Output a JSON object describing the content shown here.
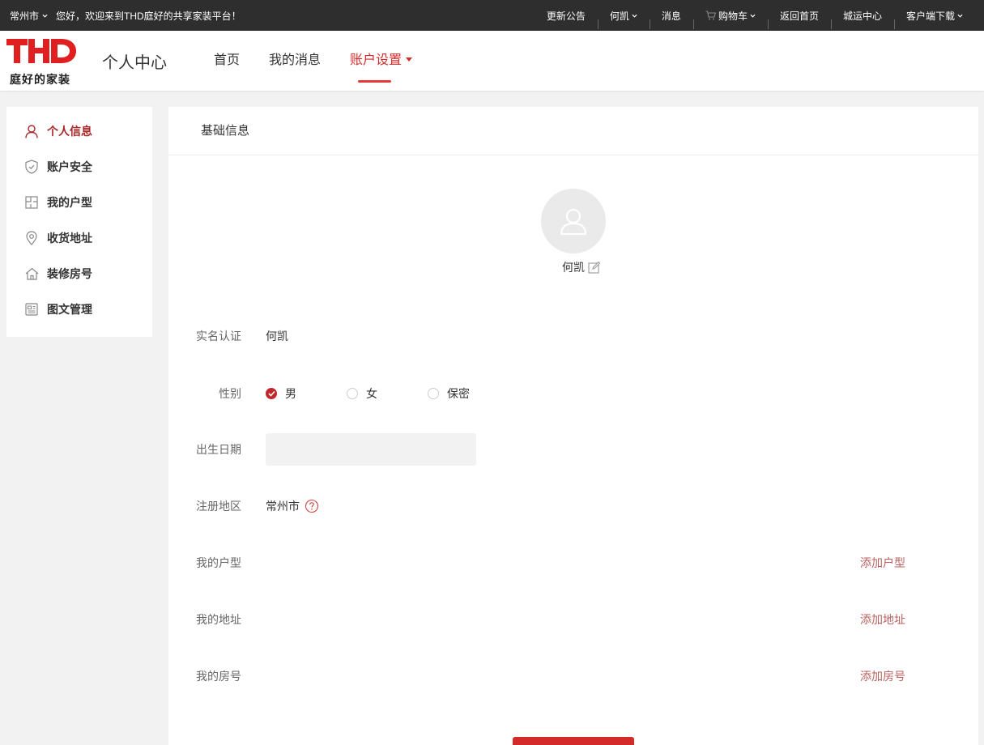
{
  "topbar": {
    "city": "常州市",
    "welcome": "您好，欢迎来到THD庭好的共享家装平台！",
    "links": [
      {
        "label": "更新公告",
        "icon": "",
        "dropdown": false
      },
      {
        "label": "何凯",
        "icon": "",
        "dropdown": true
      },
      {
        "label": "消息",
        "icon": "",
        "dropdown": false
      },
      {
        "label": "购物车",
        "icon": "cart-icon",
        "dropdown": true
      },
      {
        "label": "返回首页",
        "icon": "",
        "dropdown": false
      },
      {
        "label": "城运中心",
        "icon": "",
        "dropdown": false
      },
      {
        "label": "客户端下载",
        "icon": "",
        "dropdown": true
      }
    ]
  },
  "header": {
    "logo_text": "THD",
    "slogan": "庭好的家装",
    "title": "个人中心",
    "nav": [
      {
        "label": "首页",
        "active": false
      },
      {
        "label": "我的消息",
        "active": false
      },
      {
        "label": "账户设置",
        "active": true
      }
    ]
  },
  "sidebar": {
    "items": [
      {
        "label": "个人信息",
        "icon": "user-icon",
        "active": true
      },
      {
        "label": "账户安全",
        "icon": "shield-icon",
        "active": false
      },
      {
        "label": "我的户型",
        "icon": "floorplan-icon",
        "active": false
      },
      {
        "label": "收货地址",
        "icon": "location-icon",
        "active": false
      },
      {
        "label": "装修房号",
        "icon": "home-icon",
        "active": false
      },
      {
        "label": "图文管理",
        "icon": "image-text-icon",
        "active": false
      }
    ]
  },
  "profile": {
    "section_title": "基础信息",
    "nickname": "何凯",
    "realname_label": "实名认证",
    "realname_value": "何凯",
    "gender_label": "性别",
    "gender_options": [
      "男",
      "女",
      "保密"
    ],
    "gender_selected": "男",
    "birthday_label": "出生日期",
    "birthday_value": "",
    "region_label": "注册地区",
    "region_value": "常州市",
    "floorplan_label": "我的户型",
    "floorplan_action": "添加户型",
    "address_label": "我的地址",
    "address_action": "添加地址",
    "room_label": "我的房号",
    "room_action": "添加房号"
  },
  "colors": {
    "accent": "#d42a2a",
    "link": "#b9605e",
    "topbar_bg": "#2e2e2e"
  }
}
